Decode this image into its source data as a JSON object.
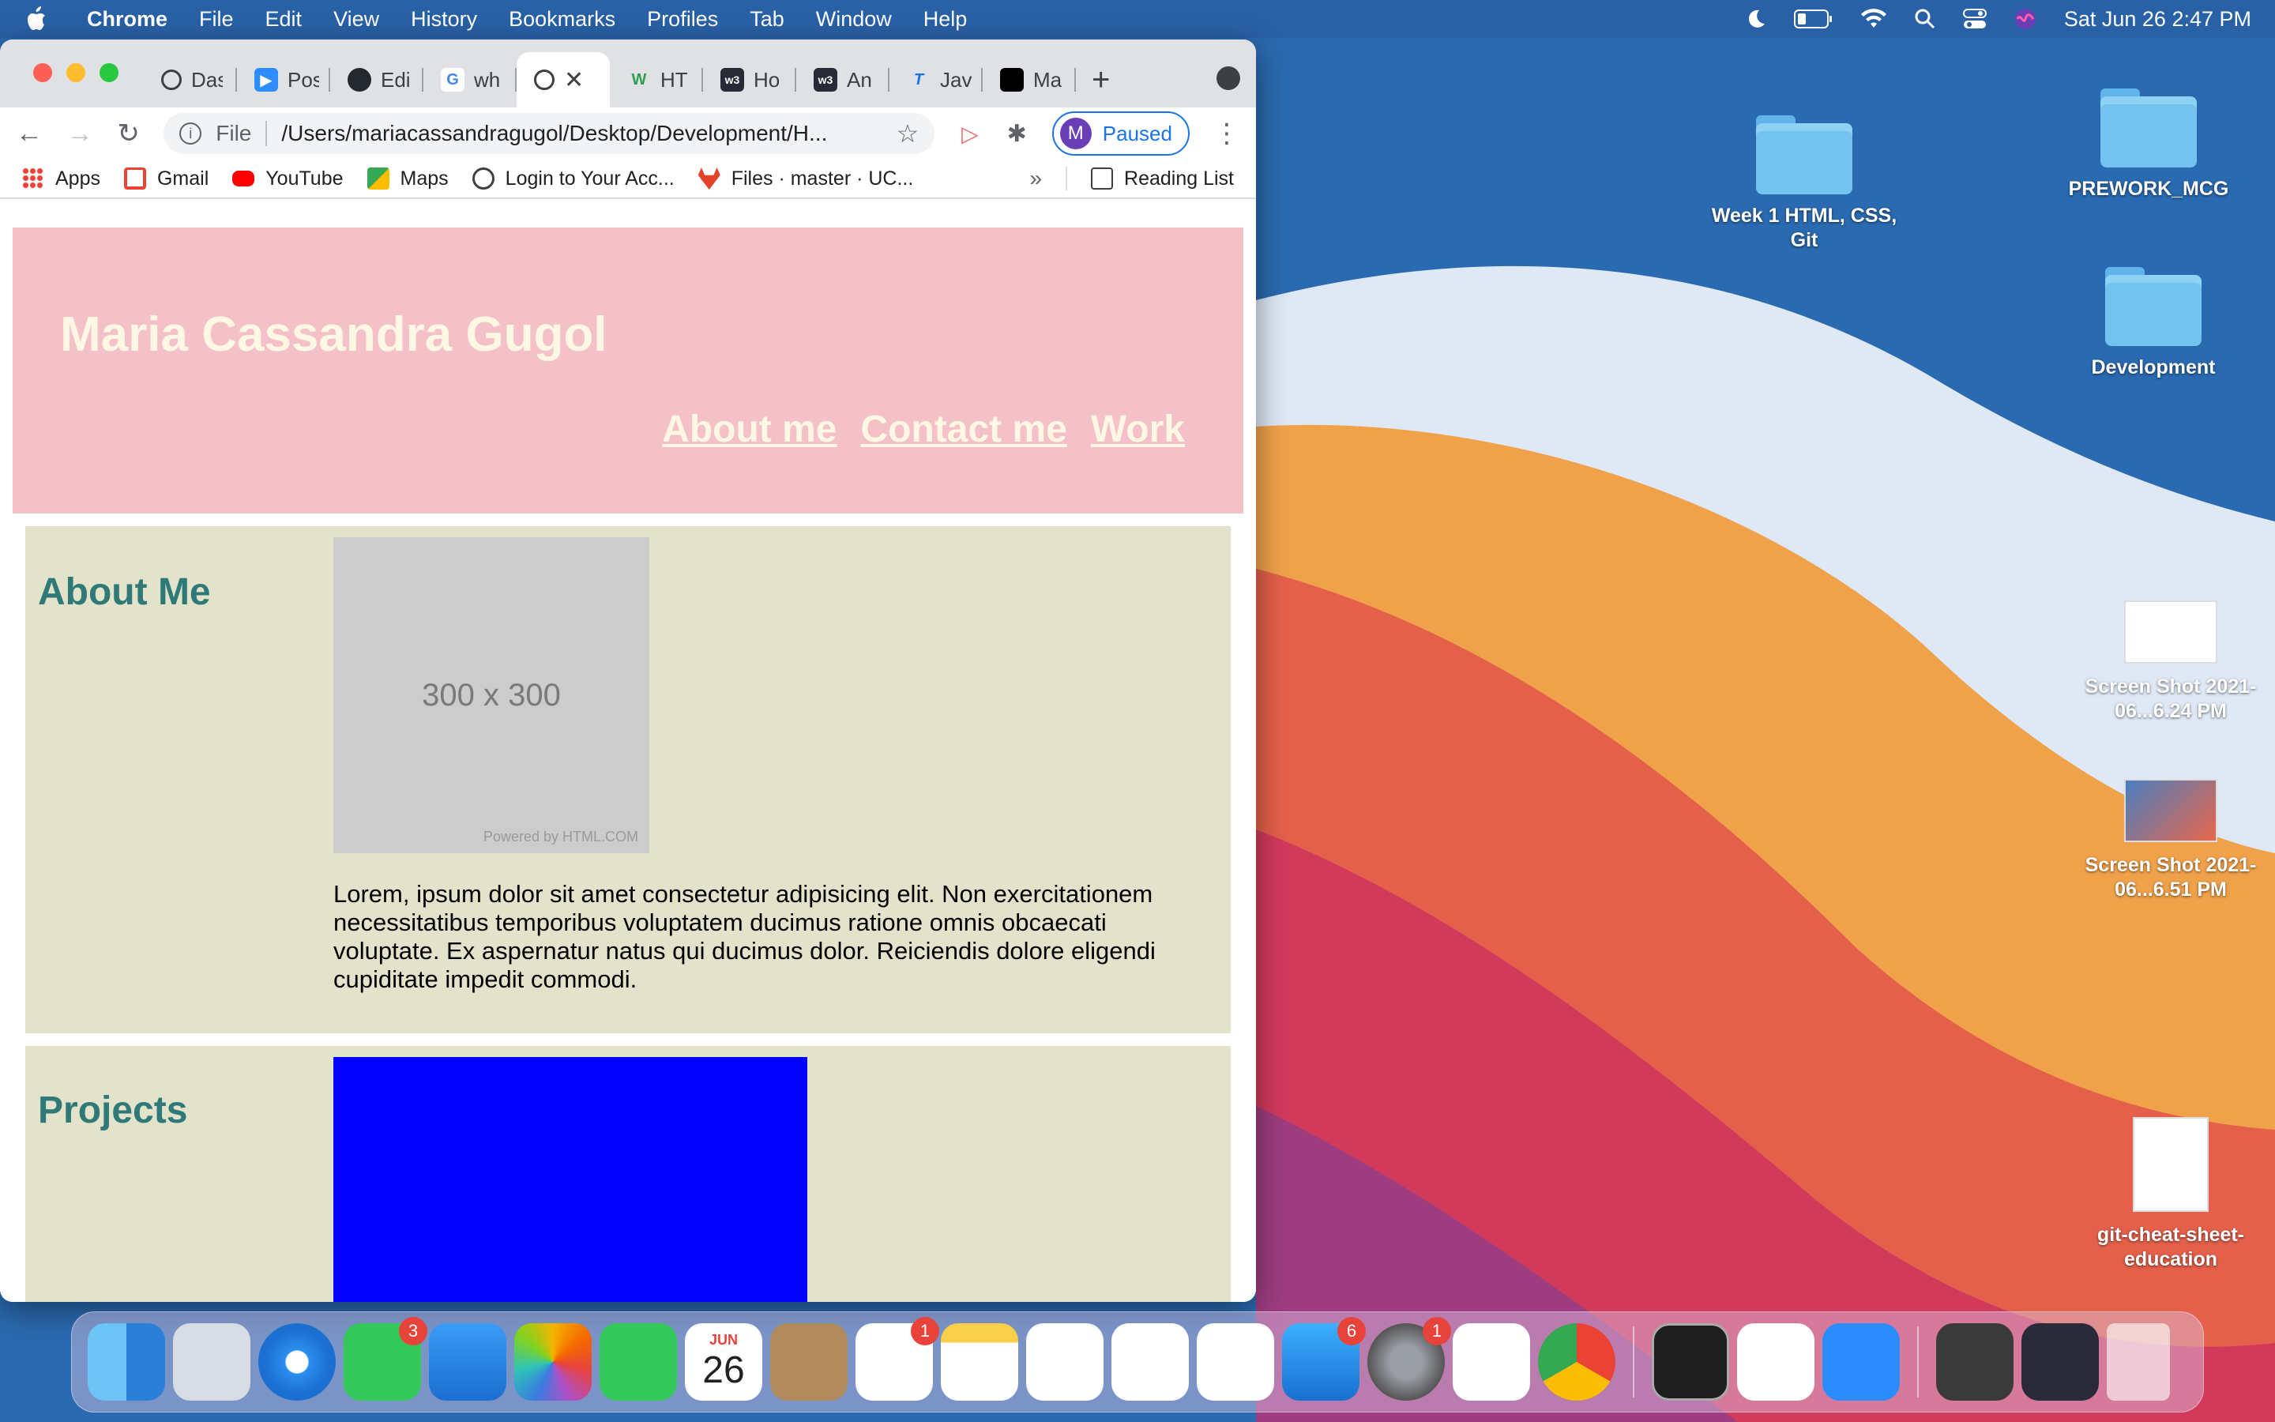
{
  "menubar": {
    "app_name": "Chrome",
    "menus": [
      "File",
      "Edit",
      "View",
      "History",
      "Bookmarks",
      "Profiles",
      "Tab",
      "Window",
      "Help"
    ],
    "clock": "Sat Jun 26  2:47 PM"
  },
  "browser": {
    "tabs": [
      {
        "label": "Das",
        "icon": "globe-icon"
      },
      {
        "label": "Pos",
        "icon": "zoom-icon"
      },
      {
        "label": "Edi",
        "icon": "github-icon"
      },
      {
        "label": "wh",
        "icon": "google-icon"
      },
      {
        "label": "",
        "icon": "globe-icon",
        "active": true
      },
      {
        "label": "HT",
        "icon": "w3-icon"
      },
      {
        "label": "Ho",
        "icon": "w3schools-icon"
      },
      {
        "label": "An",
        "icon": "w3schools-icon"
      },
      {
        "label": "Jav",
        "icon": "t-icon"
      },
      {
        "label": "Ma",
        "icon": "markdown-icon"
      }
    ],
    "omnibox": {
      "scheme_label": "File",
      "url": "/Users/mariacassandragugol/Desktop/Development/H..."
    },
    "profile": {
      "initial": "M",
      "status": "Paused"
    },
    "bookmarks": [
      {
        "label": "Apps",
        "icon": "apps-grid-icon",
        "color": "#4285f4"
      },
      {
        "label": "Gmail",
        "icon": "gmail-icon",
        "color": "#ea4335"
      },
      {
        "label": "YouTube",
        "icon": "youtube-icon",
        "color": "#ff0000"
      },
      {
        "label": "Maps",
        "icon": "maps-icon",
        "color": "#34a853"
      },
      {
        "label": "Login to Your Acc...",
        "icon": "globe-icon",
        "color": "#5f6368"
      },
      {
        "label": "Files · master · UC...",
        "icon": "gitlab-icon",
        "color": "#e24329"
      }
    ],
    "more_label": "»",
    "reading_list_label": "Reading List"
  },
  "page": {
    "title": "Maria Cassandra Gugol",
    "nav": [
      "About me",
      "Contact me",
      "Work"
    ],
    "about": {
      "heading": "About Me",
      "placeholder_label": "300 x 300",
      "powered_label": "Powered by HTML.COM",
      "paragraph": "Lorem, ipsum dolor sit amet consectetur adipisicing elit. Non exercitationem necessitatibus temporibus voluptatem ducimus ratione omnis obcaecati voluptate. Ex aspernatur natus qui ducimus dolor. Reiciendis dolore eligendi cupiditate impedit commodi."
    },
    "projects": {
      "heading": "Projects"
    },
    "colors": {
      "hero": "#f4c1c9",
      "hero_text": "#fef7e3",
      "section": "#e3e2ca",
      "heading": "#2f7a78",
      "project_box": "#0000ff"
    }
  },
  "desktop": {
    "icons": [
      {
        "label": "Week 1 HTML, CSS, Git",
        "type": "folder"
      },
      {
        "label": "PREWORK_MCG",
        "type": "folder"
      },
      {
        "label": "Development",
        "type": "folder"
      },
      {
        "label": "Screen Shot 2021-06...6.24 PM",
        "type": "screenshot"
      },
      {
        "label": "Screen Shot 2021-06...6.51 PM",
        "type": "screenshot"
      },
      {
        "label": "git-cheat-sheet-education",
        "type": "document"
      }
    ]
  },
  "dock": {
    "apps": [
      {
        "name": "finder-icon"
      },
      {
        "name": "launchpad-icon"
      },
      {
        "name": "safari-icon"
      },
      {
        "name": "messages-icon",
        "badge": "3"
      },
      {
        "name": "mail-icon"
      },
      {
        "name": "photos-icon"
      },
      {
        "name": "facetime-icon"
      },
      {
        "name": "calendar-icon",
        "month": "JUN",
        "day": "26"
      },
      {
        "name": "contacts-icon"
      },
      {
        "name": "reminders-icon",
        "badge": "1"
      },
      {
        "name": "notes-icon"
      },
      {
        "name": "keynote-icon"
      },
      {
        "name": "numbers-icon"
      },
      {
        "name": "pages-icon"
      },
      {
        "name": "app-store-icon",
        "badge": "6"
      },
      {
        "name": "system-preferences-icon",
        "badge": "1"
      },
      {
        "name": "slack-icon"
      },
      {
        "name": "chrome-icon"
      },
      {
        "name": "terminal-icon"
      },
      {
        "name": "vscode-icon"
      },
      {
        "name": "zoom-icon"
      }
    ]
  }
}
